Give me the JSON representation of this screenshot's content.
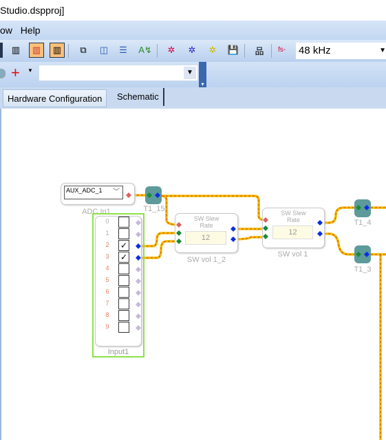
{
  "window": {
    "title": "Studio.dspproj]"
  },
  "menu": {
    "items": [
      "ow",
      "Help"
    ]
  },
  "toolbar": {
    "sample_rate_label": "fs-",
    "sample_rate": "48 kHz",
    "add_icon": "+"
  },
  "tabs": [
    {
      "label": "Hardware Configuration"
    },
    {
      "label": "Schematic",
      "active": true
    }
  ],
  "schematic": {
    "adc": {
      "select_value": "AUX_ADC_1",
      "label": "ADC In1"
    },
    "cells": {
      "t1_15": "T1_15",
      "t1_4": "T1_4",
      "t1_3": "T1_3"
    },
    "input": {
      "label": "Input1",
      "rows": [
        {
          "n": "0",
          "checked": false
        },
        {
          "n": "1",
          "checked": false
        },
        {
          "n": "2",
          "checked": true
        },
        {
          "n": "3",
          "checked": true
        },
        {
          "n": "4",
          "checked": false
        },
        {
          "n": "5",
          "checked": false
        },
        {
          "n": "6",
          "checked": false
        },
        {
          "n": "7",
          "checked": false
        },
        {
          "n": "8",
          "checked": false
        },
        {
          "n": "9",
          "checked": false
        }
      ]
    },
    "slew1": {
      "title1": "SW Slew",
      "title2": "Rate",
      "value": "12",
      "label": "SW vol 1_2"
    },
    "slew2": {
      "title1": "SW Slew",
      "title2": "Rate",
      "value": "12",
      "label": "SW vol 1"
    }
  },
  "colors": {
    "wire": "#f5b800",
    "wire_dash": "#c84a00",
    "port_in": "#1a8a3a",
    "port_out": "#0a2ee0",
    "port_ctrl": "#e06060",
    "input_border": "#8ee04a"
  }
}
